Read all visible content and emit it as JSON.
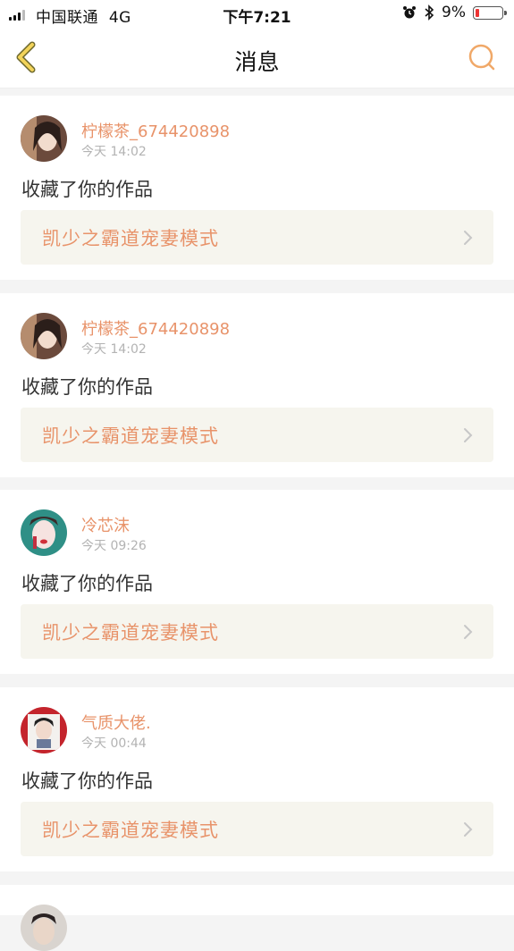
{
  "status_bar": {
    "carrier": "中国联通",
    "network": "4G",
    "time": "下午7:21",
    "battery_percent": "9%",
    "battery_level": 0.09,
    "icons": [
      "signal-icon",
      "alarm-icon",
      "bluetooth-icon",
      "battery-icon"
    ]
  },
  "nav": {
    "title": "消息",
    "back_icon": "chevron-left-icon",
    "search_icon": "search-icon",
    "accent": "#f0a868"
  },
  "colors": {
    "accent": "#e8936a",
    "work_bg": "#f6f5ee",
    "page_bg": "#f4f4f4"
  },
  "messages": [
    {
      "username": "柠檬茶_674420898",
      "time": "今天 14:02",
      "action": "收藏了你的作品",
      "work_title": "凯少之霸道宠妻模式"
    },
    {
      "username": "柠檬茶_674420898",
      "time": "今天 14:02",
      "action": "收藏了你的作品",
      "work_title": "凯少之霸道宠妻模式"
    },
    {
      "username": "冷芯沫",
      "time": "今天 09:26",
      "action": "收藏了你的作品",
      "work_title": "凯少之霸道宠妻模式"
    },
    {
      "username": "气质大佬.",
      "time": "今天 00:44",
      "action": "收藏了你的作品",
      "work_title": "凯少之霸道宠妻模式"
    }
  ]
}
